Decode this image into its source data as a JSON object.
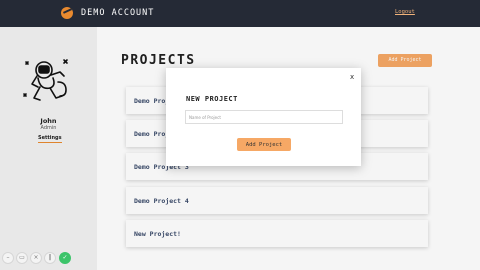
{
  "header": {
    "app_title": "DEMO ACCOUNT",
    "logout_label": "Logout"
  },
  "sidebar": {
    "user_name": "John",
    "user_role": "Admin",
    "settings_label": "Settings"
  },
  "main": {
    "page_title": "PROJECTS",
    "add_project_label": "Add Project",
    "projects": [
      "Demo Project 1",
      "Demo Project 2",
      "Demo Project 3",
      "Demo Project 4",
      "New Project!"
    ]
  },
  "modal": {
    "close_label": "x",
    "title": "NEW PROJECT",
    "name_placeholder": "Name of Project",
    "submit_label": "Add Project"
  },
  "recorder": {
    "icons": [
      "minus-icon",
      "camera-icon",
      "close-icon",
      "pause-icon",
      "check-icon"
    ],
    "glyphs": [
      "–",
      "▭",
      "×",
      "‖",
      "✓"
    ]
  },
  "colors": {
    "header_bg": "#252a36",
    "accent": "#f6a865",
    "sidebar_bg": "#f2f2f2",
    "project_text": "#3a4a6a"
  }
}
